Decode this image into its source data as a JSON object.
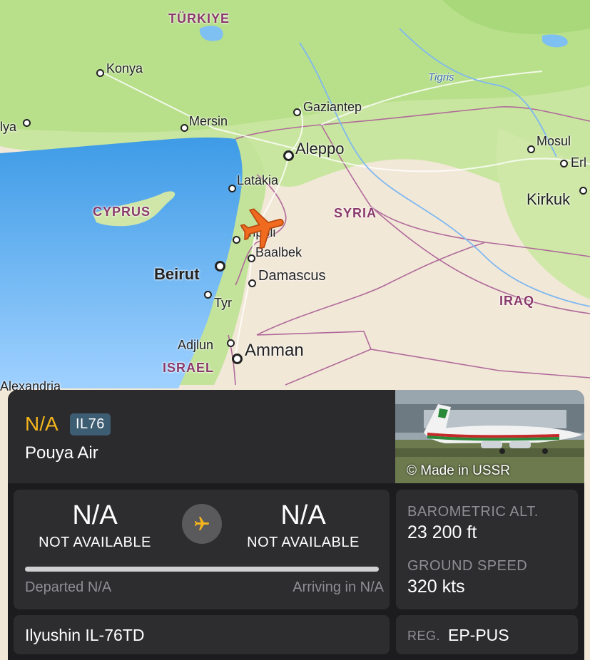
{
  "map": {
    "countries": {
      "turkiye": "TÜRKIYE",
      "cyprus": "CYPRUS",
      "syria": "SYRIA",
      "iraq": "IRAQ",
      "israel": "ISRAEL"
    },
    "cities": {
      "konya": "Konya",
      "mersin": "Mersin",
      "antalya_partial": "lya",
      "gaziantep": "Gaziantep",
      "aleppo": "Aleppo",
      "latakia": "Latakia",
      "tripoli": "Tripoli",
      "baalbek": "Baalbek",
      "beirut": "Beirut",
      "damascus": "Damascus",
      "tyr": "Tyr",
      "adjlun": "Adjlun",
      "amman": "Amman",
      "alexandria": "Alexandria",
      "mosul": "Mosul",
      "erbil_partial": "Erl",
      "kirkuk": "Kirkuk"
    },
    "rivers": {
      "tigris": "Tigris"
    }
  },
  "flight": {
    "callsign": "N/A",
    "aircraft_type_code": "IL76",
    "airline": "Pouya Air",
    "photo_credit": "© Made in USSR"
  },
  "route": {
    "origin_code": "N/A",
    "origin_name": "NOT AVAILABLE",
    "destination_code": "N/A",
    "destination_name": "NOT AVAILABLE",
    "departed_label": "Departed N/A",
    "arriving_label": "Arriving in N/A",
    "progress_percent": 0
  },
  "stats": {
    "altitude_label": "BAROMETRIC ALT.",
    "altitude_value": "23 200 ft",
    "speed_label": "GROUND SPEED",
    "speed_value": "320 kts"
  },
  "aircraft": {
    "model": "Ilyushin IL-76TD",
    "reg_label": "REG.",
    "reg_value": "EP-PUS"
  },
  "colors": {
    "accent_yellow": "#f4b51c",
    "badge_blue": "#3d5d72",
    "plane_orange": "#f06a1f",
    "panel_bg": "#1c1c1e",
    "card_bg": "#2d2d2f"
  }
}
